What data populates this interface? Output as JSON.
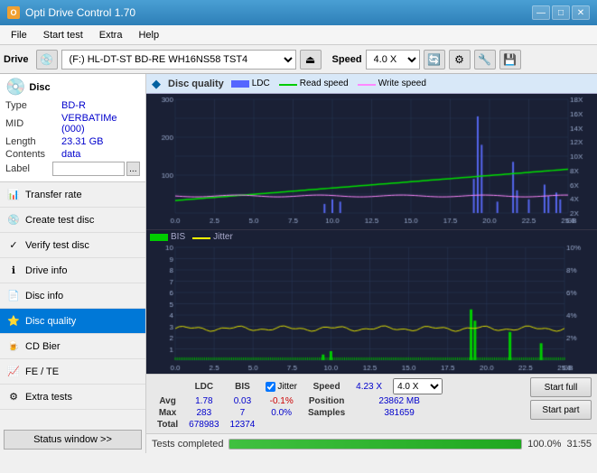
{
  "app": {
    "title": "Opti Drive Control 1.70",
    "icon": "ODC"
  },
  "titlebar": {
    "title": "Opti Drive Control 1.70",
    "minimize": "—",
    "maximize": "□",
    "close": "✕"
  },
  "menubar": {
    "items": [
      "File",
      "Start test",
      "Extra",
      "Help"
    ]
  },
  "toolbar": {
    "drive_label": "Drive",
    "drive_value": "(F:)  HL-DT-ST BD-RE  WH16NS58 TST4",
    "speed_label": "Speed",
    "speed_value": "4.0 X"
  },
  "disc": {
    "header": "Disc",
    "type_label": "Type",
    "type_value": "BD-R",
    "mid_label": "MID",
    "mid_value": "VERBATIMe (000)",
    "length_label": "Length",
    "length_value": "23.31 GB",
    "contents_label": "Contents",
    "contents_value": "data",
    "label_label": "Label",
    "label_value": ""
  },
  "nav": {
    "items": [
      {
        "id": "transfer-rate",
        "label": "Transfer rate",
        "icon": "📊",
        "active": false
      },
      {
        "id": "create-test-disc",
        "label": "Create test disc",
        "icon": "💿",
        "active": false
      },
      {
        "id": "verify-test-disc",
        "label": "Verify test disc",
        "icon": "✓",
        "active": false
      },
      {
        "id": "drive-info",
        "label": "Drive info",
        "icon": "ℹ",
        "active": false
      },
      {
        "id": "disc-info",
        "label": "Disc info",
        "icon": "📄",
        "active": false
      },
      {
        "id": "disc-quality",
        "label": "Disc quality",
        "icon": "⭐",
        "active": true
      },
      {
        "id": "cd-bier",
        "label": "CD Bier",
        "icon": "🍺",
        "active": false
      },
      {
        "id": "fe-te",
        "label": "FE / TE",
        "icon": "📈",
        "active": false
      },
      {
        "id": "extra-tests",
        "label": "Extra tests",
        "icon": "⚙",
        "active": false
      }
    ]
  },
  "chart": {
    "title": "Disc quality",
    "icon": "◆",
    "legend": {
      "ldc": "LDC",
      "read_speed": "Read speed",
      "write_speed": "Write speed",
      "bis": "BIS",
      "jitter": "Jitter"
    },
    "top_chart": {
      "y_max": 300,
      "y_labels_left": [
        "300",
        "200",
        "100",
        ""
      ],
      "y_labels_right": [
        "18X",
        "16X",
        "14X",
        "12X",
        "10X",
        "8X",
        "6X",
        "4X",
        "2X"
      ],
      "x_labels": [
        "0.0",
        "2.5",
        "5.0",
        "7.5",
        "10.0",
        "12.5",
        "15.0",
        "17.5",
        "20.0",
        "22.5",
        "25.0 GB"
      ]
    },
    "bottom_chart": {
      "y_max": 10,
      "y_labels_left": [
        "10",
        "9",
        "8",
        "7",
        "6",
        "5",
        "4",
        "3",
        "2",
        "1"
      ],
      "y_labels_right": [
        "10%",
        "8%",
        "6%",
        "4%",
        "2%"
      ],
      "x_labels": [
        "0.0",
        "2.5",
        "5.0",
        "7.5",
        "10.0",
        "12.5",
        "15.0",
        "17.5",
        "20.0",
        "22.5",
        "25.0 GB"
      ]
    }
  },
  "stats": {
    "columns": [
      "",
      "LDC",
      "BIS",
      "",
      "Jitter",
      "Speed",
      ""
    ],
    "avg_label": "Avg",
    "max_label": "Max",
    "total_label": "Total",
    "ldc_avg": "1.78",
    "ldc_max": "283",
    "ldc_total": "678983",
    "bis_avg": "0.03",
    "bis_max": "7",
    "bis_total": "12374",
    "jitter_avg": "-0.1%",
    "jitter_max": "0.0%",
    "speed_label": "Speed",
    "speed_value": "4.23 X",
    "speed_select": "4.0 X",
    "position_label": "Position",
    "position_value": "23862 MB",
    "samples_label": "Samples",
    "samples_value": "381659",
    "jitter_checked": true,
    "jitter_label": "Jitter"
  },
  "buttons": {
    "start_full": "Start full",
    "start_part": "Start part"
  },
  "statusbar": {
    "status_window": "Status window >>",
    "status_text": "Tests completed",
    "progress_percent": "100.0%",
    "time": "31:55"
  }
}
